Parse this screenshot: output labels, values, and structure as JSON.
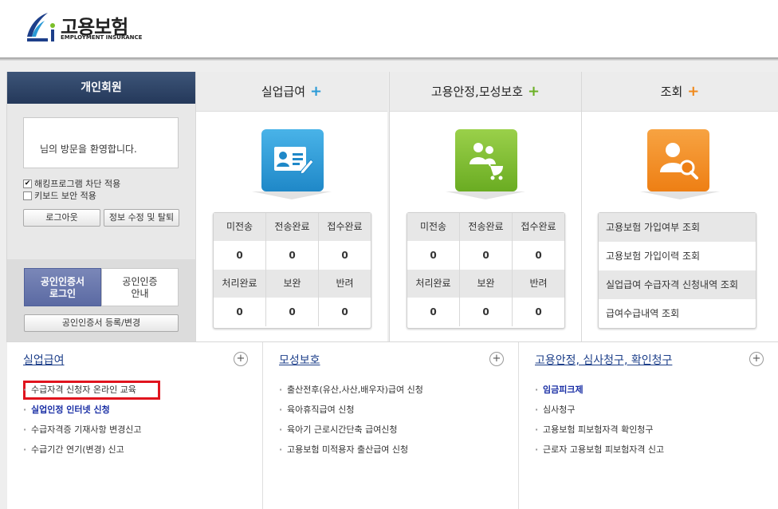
{
  "header": {
    "brand_ko": "고용보험",
    "brand_en": "EMPLOYMENT INSURANCE"
  },
  "personal": {
    "tab": "개인회원",
    "greeting": "님의 방문을 환영합니다.",
    "check1": "해킹프로그램 차단 적용",
    "check1_checked": true,
    "check2": "키보드 보안 적용",
    "check2_checked": false,
    "logout": "로그아웃",
    "edit": "정보 수정 및 탈퇴",
    "cert_login_1": "공인인증서",
    "cert_login_2": "로그인",
    "cert_guide_1": "공인인증",
    "cert_guide_2": "안내",
    "cert_register": "공인인증서 등록/변경"
  },
  "columns": [
    {
      "title": "실업급여",
      "plus": "+",
      "plus_color": "#2a9ad6",
      "icon": "id-card-icon",
      "icon_color": "#2a9ad6",
      "stats_head1": [
        "미전송",
        "전송완료",
        "접수완료"
      ],
      "stats_val1": [
        "0",
        "0",
        "0"
      ],
      "stats_head2": [
        "처리완료",
        "보완",
        "반려"
      ],
      "stats_val2": [
        "0",
        "0",
        "0"
      ]
    },
    {
      "title": "고용안정,모성보호",
      "plus": "+",
      "plus_color": "#6bb025",
      "icon": "family-stroller-icon",
      "icon_color": "#7bbf2a",
      "stats_head1": [
        "미전송",
        "전송완료",
        "접수완료"
      ],
      "stats_val1": [
        "0",
        "0",
        "0"
      ],
      "stats_head2": [
        "처리완료",
        "보완",
        "반려"
      ],
      "stats_val2": [
        "0",
        "0",
        "0"
      ]
    },
    {
      "title": "조회",
      "plus": "+",
      "plus_color": "#f08a1c",
      "icon": "user-search-icon",
      "icon_color": "#f08a1c",
      "items": [
        "고용보험 가입여부 조회",
        "고용보험 가입이력 조회",
        "실업급여 수급자격 신청내역 조회",
        "급여수급내역 조회"
      ]
    }
  ],
  "menus": [
    {
      "title": "실업급여",
      "plus": "+",
      "items": [
        "수급자격 신청자 온라인 교육",
        "실업인정 인터넷 신청",
        "수급자격증 기재사항 변경신고",
        "수급기간 연기(변경) 신고"
      ]
    },
    {
      "title": "모성보호",
      "plus": "+",
      "items": [
        "출산전후(유산,사산,배우자)급여 신청",
        "육아휴직급여 신청",
        "육아기 근로시간단축 급여신청",
        "고용보험 미적용자 출산급여 신청"
      ]
    },
    {
      "title": "고용안정, 심사청구, 확인청구",
      "plus": "+",
      "items": [
        "임금피크제",
        "심사청구",
        "고용보험 피보험자격 확인청구",
        "근로자 고용보험 피보험자격 신고"
      ]
    }
  ]
}
